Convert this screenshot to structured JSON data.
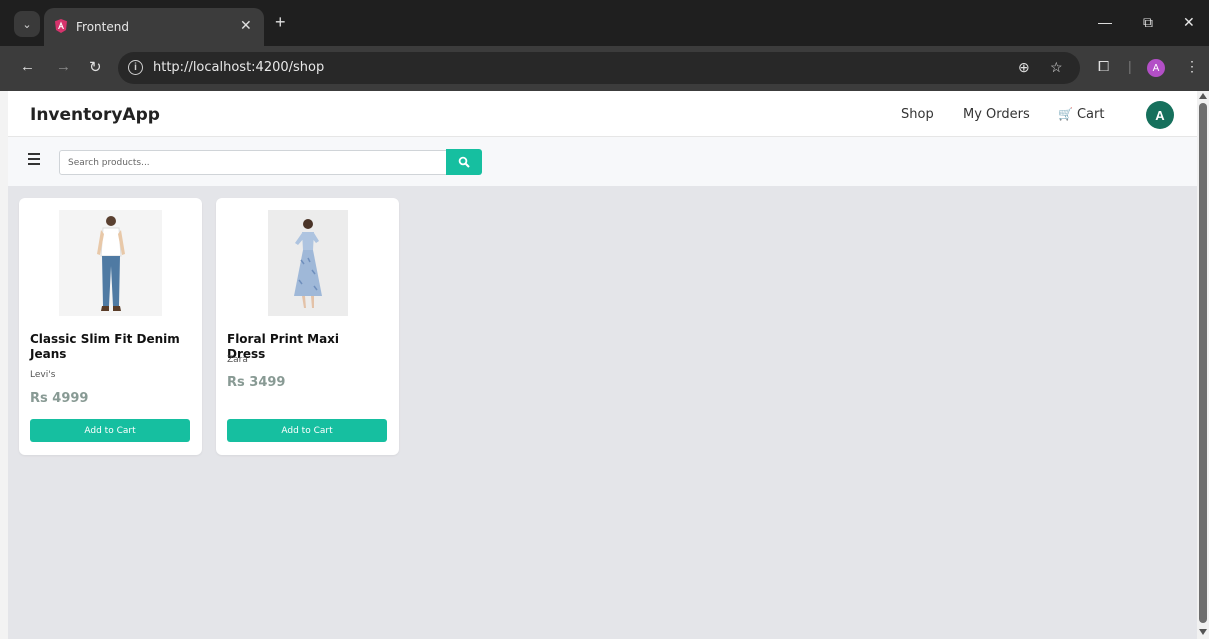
{
  "browser": {
    "tab_title": "Frontend",
    "url": "http://localhost:4200/shop",
    "profile_initial": "A"
  },
  "app": {
    "brand": "InventoryApp",
    "nav": {
      "shop": "Shop",
      "my_orders": "My Orders",
      "cart": "Cart"
    },
    "avatar_initial": "A",
    "search": {
      "placeholder": "Search products..."
    },
    "products": [
      {
        "title": "Classic Slim Fit Denim Jeans",
        "brand": "Levi's",
        "price": "Rs 4999",
        "button": "Add to Cart"
      },
      {
        "title": "Floral Print Maxi Dress",
        "brand": "Zara",
        "price": "Rs 3499",
        "button": "Add to Cart"
      }
    ]
  },
  "colors": {
    "accent": "#16bfa0",
    "avatar": "#16705c",
    "price": "#889a94",
    "page_bg": "#e4e5e9"
  }
}
